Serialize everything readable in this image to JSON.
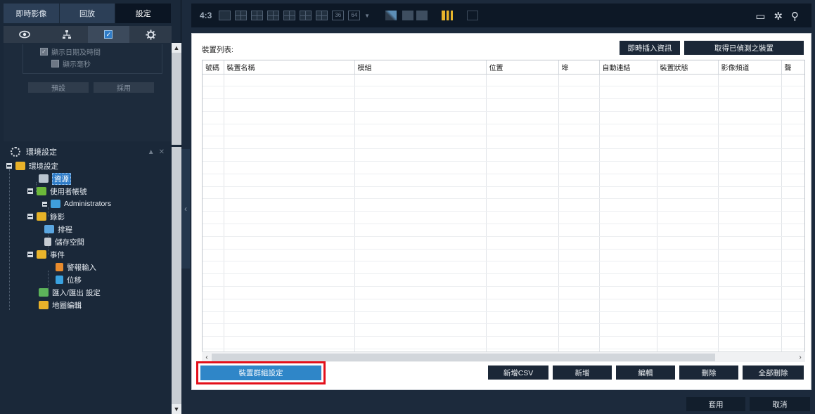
{
  "main_tabs": [
    {
      "label": "即時影像"
    },
    {
      "label": "回放"
    },
    {
      "label": "設定"
    }
  ],
  "settings_options": {
    "show_date_time": "顯示日期及時間",
    "show_ms": "顯示毫秒",
    "default_btn": "預設",
    "apply_btn": "採用"
  },
  "env_panel": {
    "title": "環境設定",
    "tree": {
      "root": "環境設定",
      "resources": "資源",
      "user_accounts": "使用者帳號",
      "administrators": "Administrators",
      "recording": "錄影",
      "schedule": "排程",
      "storage": "儲存空間",
      "events": "事件",
      "alarm_input": "警報輸入",
      "motion": "位移",
      "import_export": "匯入/匯出 設定",
      "map_edit": "地圖編輯"
    }
  },
  "toolbar": {
    "ratio": "4:3",
    "layout_36": "36",
    "layout_64": "64"
  },
  "device_list": {
    "label": "裝置列表:",
    "instant_insert_btn": "即時插入資訊",
    "get_detected_btn": "取得已偵測之裝置",
    "columns": [
      "號碼",
      "裝置名稱",
      "模組",
      "位置",
      "埠",
      "自動連結",
      "裝置狀態",
      "影像頻道",
      "聲"
    ],
    "rows": []
  },
  "actions": {
    "group_settings": "裝置群組設定",
    "add_csv": "新增CSV",
    "add": "新增",
    "edit": "編輯",
    "delete": "刪除",
    "delete_all": "全部刪除"
  },
  "footer": {
    "apply": "套用",
    "cancel": "取消"
  }
}
